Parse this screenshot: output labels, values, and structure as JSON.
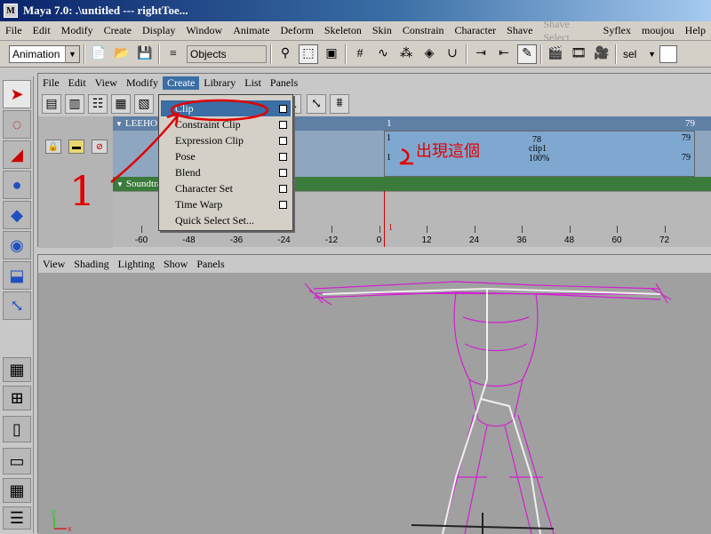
{
  "window": {
    "title": "Maya 7.0: .\\untitled    ---    rightToe...",
    "logo": "M"
  },
  "menubar": [
    "File",
    "Edit",
    "Modify",
    "Create",
    "Display",
    "Window",
    "Animate",
    "Deform",
    "Skeleton",
    "Skin",
    "Constrain",
    "Character",
    "Shave",
    "Shave Select",
    "Syflex",
    "moujou",
    "Help"
  ],
  "menubar_disabled_index": 13,
  "shelf": {
    "mode_select": "Animation",
    "objects_field": "Objects",
    "sel_label": "sel"
  },
  "trax": {
    "menu": [
      "File",
      "Edit",
      "View",
      "Modify",
      "Create",
      "Library",
      "List",
      "Panels"
    ],
    "active_menu": "Create",
    "track_label": "LEEHO",
    "sound_label": "Soundtra",
    "clip": {
      "start_top": "1",
      "end_top": "79",
      "start_label": "1",
      "length_label": "78",
      "name": "clip1",
      "end_label": "79",
      "start_bottom": "1",
      "percent": "100%",
      "end_bottom": "79"
    },
    "ruler_ticks": [
      "-60",
      "-48",
      "-36",
      "-24",
      "-12",
      "0",
      "12",
      "24",
      "36",
      "48",
      "60",
      "72"
    ],
    "current_frame": "1"
  },
  "create_menu": {
    "items": [
      "Clip",
      "Constraint Clip",
      "Expression Clip",
      "Pose",
      "Blend",
      "Character Set",
      "Time Warp",
      "Quick Select Set..."
    ],
    "has_option_box": [
      true,
      true,
      true,
      true,
      true,
      true,
      true,
      false
    ],
    "highlighted_index": 0
  },
  "viewport": {
    "menu": [
      "View",
      "Shading",
      "Lighting",
      "Show",
      "Panels"
    ]
  },
  "annotations": {
    "number_label": "1",
    "note_text": "出現這個"
  },
  "colors": {
    "title_start": "#0a246a",
    "highlight": "#3a6ea5",
    "annotation": "#e00000",
    "wireframe": "#d020d0",
    "sound_track": "#3a7a3a"
  }
}
